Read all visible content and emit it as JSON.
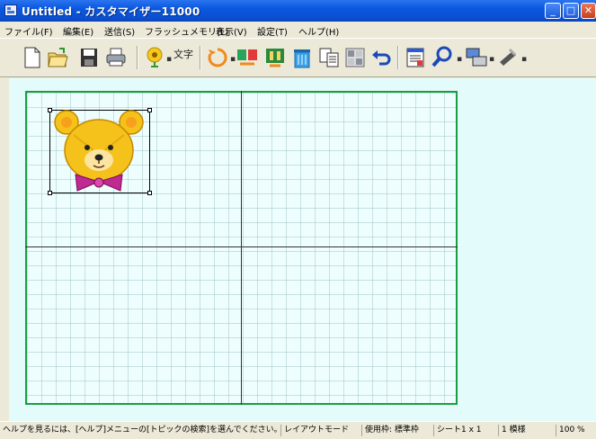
{
  "window": {
    "title": "Untitled - カスタマイザー11000"
  },
  "menu": [
    "ファイル(F)",
    "編集(E)",
    "送信(S)",
    "フラッシュメモリ(L)",
    "表示(V)",
    "設定(T)",
    "ヘルプ(H)"
  ],
  "toolbar": {
    "text_icon_glyph": "文字"
  },
  "colors": {
    "titlebar": "#0b4fcf",
    "sheet_border": "#18a040",
    "workspace_bg": "#e4fbfb",
    "bear_fur": "#f5c21b",
    "bow": "#c0298f"
  },
  "status": {
    "help": "ヘルプを見るには、[ヘルプ]メニューの[トピックの検索]を選んでください。",
    "mode": "レイアウトモード",
    "frame": "使用枠: 標準枠",
    "sheet": "シート1 x 1",
    "pattern": "1 模様",
    "zoom": "100 %"
  }
}
